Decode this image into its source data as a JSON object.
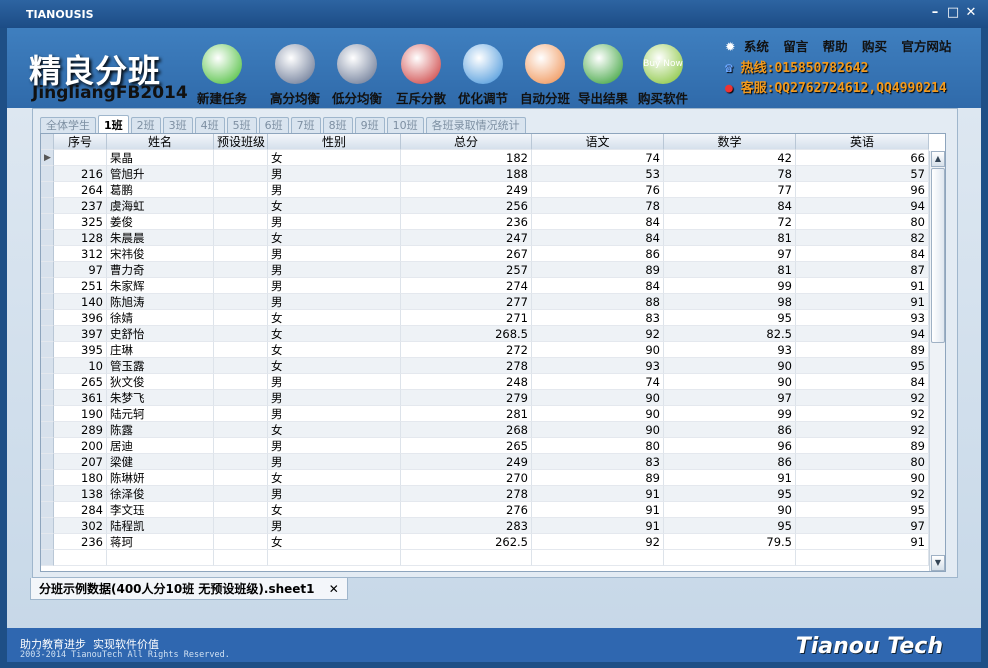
{
  "window": {
    "title": "TIANOUSIS"
  },
  "logo": {
    "cn": "精良分班",
    "en": "JingliangFB2014"
  },
  "toolbar": [
    {
      "label": "新建任务",
      "icon": "plus-icon",
      "color": "#3cb82a"
    },
    {
      "label": "高分均衡",
      "icon": "document-clock-icon",
      "color": "#5a6a8a"
    },
    {
      "label": "低分均衡",
      "icon": "document-clock-icon",
      "color": "#5a6a8a"
    },
    {
      "label": "互斥分散",
      "icon": "people-arrows-icon",
      "color": "#c83030"
    },
    {
      "label": "优化调节",
      "icon": "toggle-arrows-icon",
      "color": "#3a8ed8"
    },
    {
      "label": "自动分班",
      "icon": "color-wheel-icon",
      "color": "#e84"
    },
    {
      "label": "导出结果",
      "icon": "excel-icon",
      "color": "#2a9a2a"
    },
    {
      "label": "购买软件",
      "icon": "buy-now-badge-icon",
      "color": "#7cbf2a",
      "badge": "Buy Now"
    }
  ],
  "links": [
    "系统",
    "留言",
    "帮助",
    "购买",
    "官方网站"
  ],
  "hotline": "热线:015850782642",
  "service": "客服:QQ2762724612,QQ4990214",
  "tabs": [
    "全体学生",
    "1班",
    "2班",
    "3班",
    "4班",
    "5班",
    "6班",
    "7班",
    "8班",
    "9班",
    "10班",
    "各班录取情况统计"
  ],
  "active_tab": 1,
  "columns": [
    "序号",
    "姓名",
    "预设班级",
    "性别",
    "总分",
    "语文",
    "数学",
    "英语"
  ],
  "rows": [
    [
      "",
      "杲晶",
      "",
      "女",
      "182",
      "74",
      "42",
      "66"
    ],
    [
      "216",
      "管旭升",
      "",
      "男",
      "188",
      "53",
      "78",
      "57"
    ],
    [
      "264",
      "葛鹏",
      "",
      "男",
      "249",
      "76",
      "77",
      "96"
    ],
    [
      "237",
      "虞海虹",
      "",
      "女",
      "256",
      "78",
      "84",
      "94"
    ],
    [
      "325",
      "姜俊",
      "",
      "男",
      "236",
      "84",
      "72",
      "80"
    ],
    [
      "128",
      "朱晨晨",
      "",
      "女",
      "247",
      "84",
      "81",
      "82"
    ],
    [
      "312",
      "宋祎俊",
      "",
      "男",
      "267",
      "86",
      "97",
      "84"
    ],
    [
      "97",
      "曹力奇",
      "",
      "男",
      "257",
      "89",
      "81",
      "87"
    ],
    [
      "251",
      "朱家辉",
      "",
      "男",
      "274",
      "84",
      "99",
      "91"
    ],
    [
      "140",
      "陈旭涛",
      "",
      "男",
      "277",
      "88",
      "98",
      "91"
    ],
    [
      "396",
      "徐婧",
      "",
      "女",
      "271",
      "83",
      "95",
      "93"
    ],
    [
      "397",
      "史舒怡",
      "",
      "女",
      "268.5",
      "92",
      "82.5",
      "94"
    ],
    [
      "395",
      "庄琳",
      "",
      "女",
      "272",
      "90",
      "93",
      "89"
    ],
    [
      "10",
      "管玉露",
      "",
      "女",
      "278",
      "93",
      "90",
      "95"
    ],
    [
      "265",
      "狄文俊",
      "",
      "男",
      "248",
      "74",
      "90",
      "84"
    ],
    [
      "361",
      "朱梦飞",
      "",
      "男",
      "279",
      "90",
      "97",
      "92"
    ],
    [
      "190",
      "陆元轲",
      "",
      "男",
      "281",
      "90",
      "99",
      "92"
    ],
    [
      "289",
      "陈露",
      "",
      "女",
      "268",
      "90",
      "86",
      "92"
    ],
    [
      "200",
      "居迪",
      "",
      "男",
      "265",
      "80",
      "96",
      "89"
    ],
    [
      "207",
      "梁健",
      "",
      "男",
      "249",
      "83",
      "86",
      "80"
    ],
    [
      "180",
      "陈琳妍",
      "",
      "女",
      "270",
      "89",
      "91",
      "90"
    ],
    [
      "138",
      "徐泽俊",
      "",
      "男",
      "278",
      "91",
      "95",
      "92"
    ],
    [
      "284",
      "李文珏",
      "",
      "女",
      "276",
      "91",
      "90",
      "95"
    ],
    [
      "302",
      "陆程凯",
      "",
      "男",
      "283",
      "91",
      "95",
      "97"
    ],
    [
      "236",
      "蒋珂",
      "",
      "女",
      "262.5",
      "92",
      "79.5",
      "91"
    ]
  ],
  "document_tab": {
    "label": "分班示例数据(400人分10班 无预设班级).sheet1",
    "close": "✕"
  },
  "footer": {
    "slogan": "助力教育进步  实现软件价值",
    "copyright": "2003-2014 TianouTech All Rights Reserved.",
    "brand": "Tianou Tech"
  }
}
